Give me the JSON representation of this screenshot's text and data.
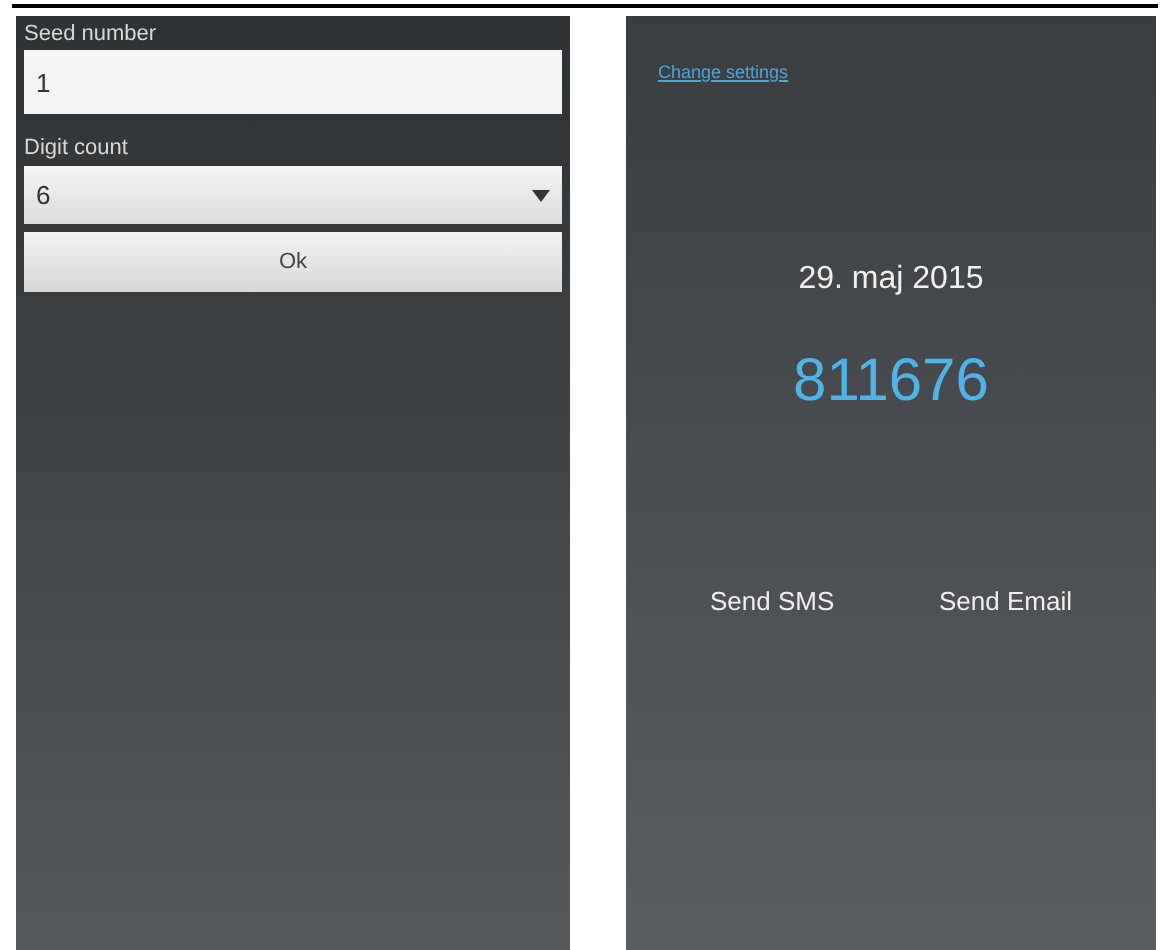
{
  "settings_screen": {
    "seed_label": "Seed number",
    "seed_value": "1",
    "digit_label": "Digit count",
    "digit_value": "6",
    "ok_button": "Ok"
  },
  "code_screen": {
    "change_link": "Change settings",
    "date": "29. maj 2015",
    "code": "811676",
    "actions": [
      "Send SMS",
      "Send Email"
    ]
  }
}
